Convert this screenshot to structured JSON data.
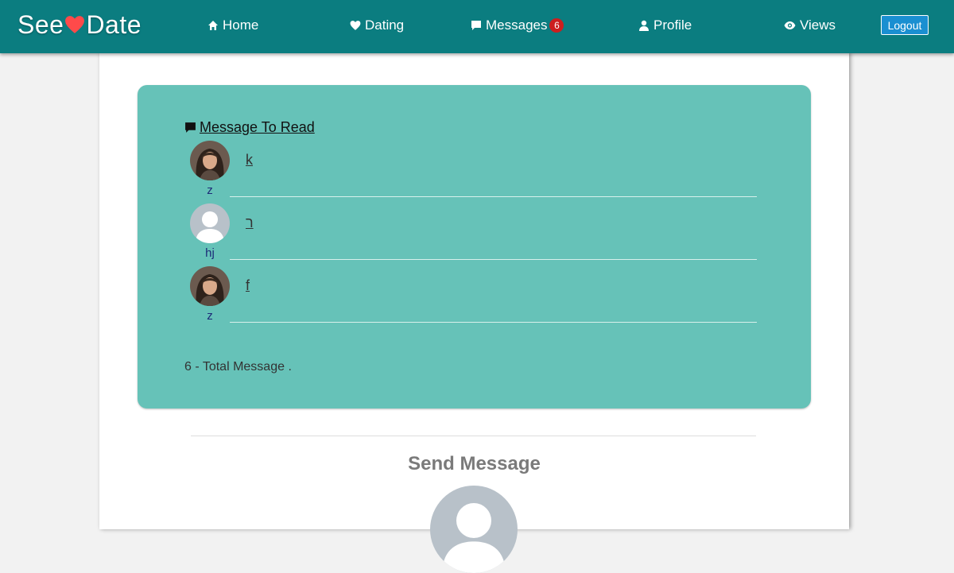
{
  "brand": {
    "part1": "See",
    "part2": "Date",
    "heart_color": "#ff4a4a"
  },
  "nav": {
    "home": "Home",
    "dating": "Dating",
    "messages": "Messages",
    "messages_count": "6",
    "profile": "Profile",
    "views": "Views",
    "logout": "Logout"
  },
  "inbox": {
    "title": "Message To Read",
    "messages": [
      {
        "sender": "z",
        "text": "k",
        "avatar": "photo-female"
      },
      {
        "sender": "hj",
        "text": "ר",
        "avatar": "default-silhouette"
      },
      {
        "sender": "z",
        "text": "f",
        "avatar": "photo-female"
      }
    ],
    "total": "6 - Total Message ."
  },
  "send": {
    "title": "Send Message",
    "avatar": "default-silhouette"
  },
  "colors": {
    "navbar": "#0b7d80",
    "card": "#66c2b8",
    "logout": "#1a8fd1",
    "badge": "#cc1e1e"
  }
}
